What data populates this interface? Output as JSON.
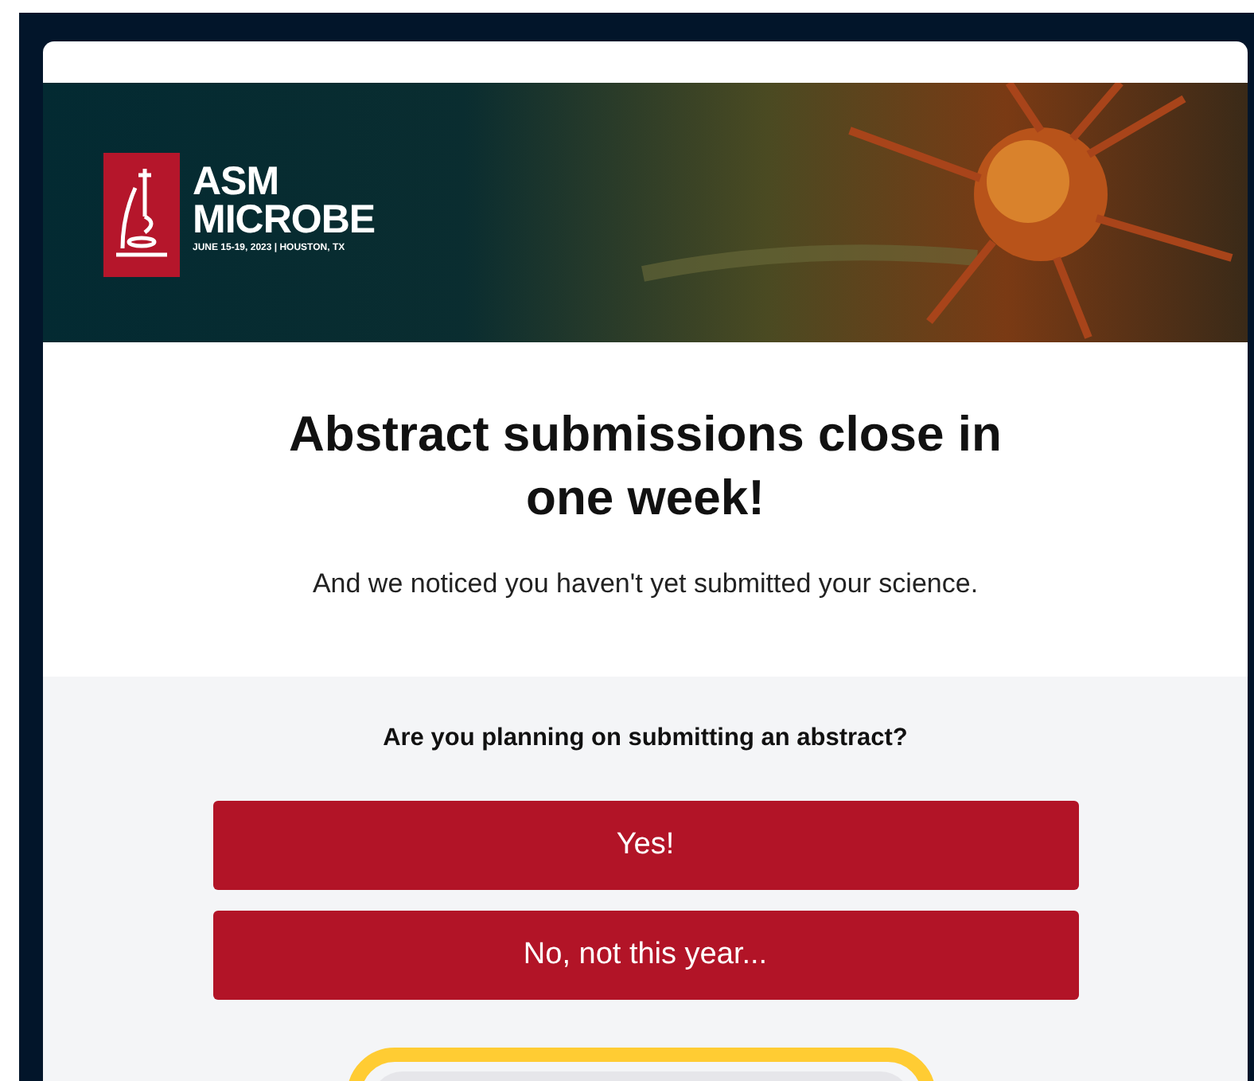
{
  "banner": {
    "logo_line_1": "ASM",
    "logo_line_2": "MICROBE",
    "logo_tagline": "JUNE 15-19, 2023 | HOUSTON, TX"
  },
  "headline": "Abstract submissions close in one week!",
  "subtext": "And we noticed you haven't yet submitted your science.",
  "question": "Are you planning on submitting an abstract?",
  "buttons": [
    {
      "label": "Yes!"
    },
    {
      "label": "No, not this year..."
    }
  ]
}
